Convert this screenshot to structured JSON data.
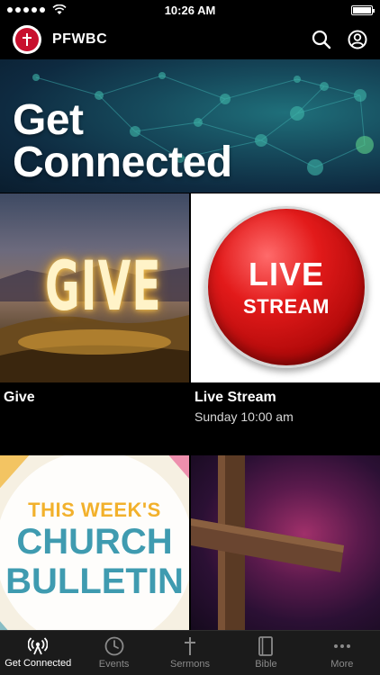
{
  "status_bar": {
    "time": "10:26 AM"
  },
  "header": {
    "app_title": "PFWBC",
    "logo_icon": "church-cross-logo-icon",
    "search_icon": "search-icon",
    "profile_icon": "profile-icon"
  },
  "hero": {
    "title_line1": "Get",
    "title_line2": "Connected"
  },
  "tiles": [
    {
      "id": "give",
      "image_text": "GIVE",
      "title": "Give",
      "subtitle": ""
    },
    {
      "id": "live-stream",
      "image_text_1": "LIVE",
      "image_text_2": "STREAM",
      "title": "Live Stream",
      "subtitle": "Sunday 10:00 am"
    },
    {
      "id": "bulletin",
      "image_text_1": "THIS WEEK'S",
      "image_text_2": "CHURCH",
      "image_text_3": "BULLETIN"
    },
    {
      "id": "cross",
      "image": "wooden-cross-image"
    }
  ],
  "tab_bar": {
    "items": [
      {
        "label": "Get Connected",
        "icon": "broadcast-icon",
        "active": true
      },
      {
        "label": "Events",
        "icon": "clock-icon",
        "active": false
      },
      {
        "label": "Sermons",
        "icon": "cross-icon",
        "active": false
      },
      {
        "label": "Bible",
        "icon": "book-icon",
        "active": false
      },
      {
        "label": "More",
        "icon": "more-dots-icon",
        "active": false
      }
    ]
  },
  "colors": {
    "accent_red": "#c8102e",
    "tab_bar_bg": "#1b1b1b",
    "tab_inactive": "#8a8a8a",
    "bulletin_blue": "#3f9bb0",
    "bulletin_gold": "#f2b12c"
  }
}
